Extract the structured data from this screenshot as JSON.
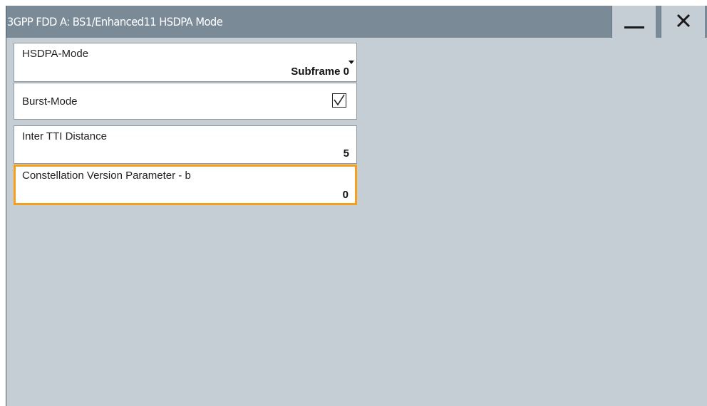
{
  "window": {
    "title": "3GPP FDD A: BS1/Enhanced11 HSDPA Mode",
    "minimize_icon": "minimize-icon",
    "close_icon": "close-icon"
  },
  "params": {
    "hsdpa_mode": {
      "label": "HSDPA-Mode",
      "value": "Subframe 0",
      "control": "dropdown"
    },
    "burst_mode": {
      "label": "Burst-Mode",
      "checked": true
    },
    "inter_tti_distance": {
      "label": "Inter TTI Distance",
      "value": "5"
    },
    "constellation_version": {
      "label": "Constellation Version Parameter - b",
      "value": "0",
      "focused": true
    }
  },
  "colors": {
    "titlebar": "#7b8a97",
    "background": "#c4ced4",
    "focus_border": "#f5a01a"
  }
}
